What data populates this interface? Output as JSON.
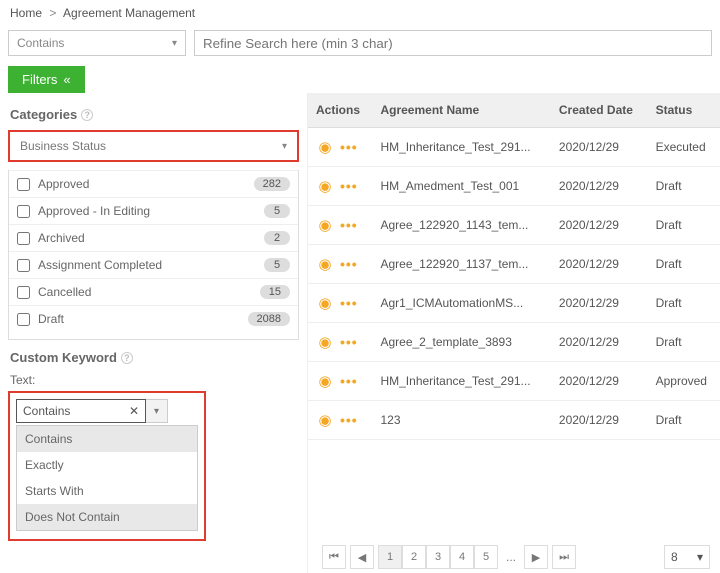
{
  "breadcrumb": {
    "home": "Home",
    "sep": ">",
    "current": "Agreement Management"
  },
  "search": {
    "mode": "Contains",
    "placeholder": "Refine Search here (min 3 char)"
  },
  "filters": {
    "label": "Filters",
    "glyph": "«"
  },
  "categories": {
    "title": "Categories",
    "selector": "Business Status",
    "items": [
      {
        "label": "Approved",
        "count": "282"
      },
      {
        "label": "Approved - In Editing",
        "count": "5"
      },
      {
        "label": "Archived",
        "count": "2"
      },
      {
        "label": "Assignment Completed",
        "count": "5"
      },
      {
        "label": "Cancelled",
        "count": "15"
      },
      {
        "label": "Draft",
        "count": "2088"
      }
    ]
  },
  "custom": {
    "title": "Custom Keyword",
    "text_label": "Text:",
    "value": "Contains",
    "options": [
      "Contains",
      "Exactly",
      "Starts With",
      "Does Not Contain"
    ]
  },
  "table": {
    "headers": {
      "actions": "Actions",
      "name": "Agreement Name",
      "date": "Created Date",
      "status": "Status"
    },
    "rows": [
      {
        "name": "HM_Inheritance_Test_291...",
        "date": "2020/12/29",
        "status": "Executed"
      },
      {
        "name": "HM_Amedment_Test_001",
        "date": "2020/12/29",
        "status": "Draft"
      },
      {
        "name": "Agree_122920_1143_tem...",
        "date": "2020/12/29",
        "status": "Draft"
      },
      {
        "name": "Agree_122920_1137_tem...",
        "date": "2020/12/29",
        "status": "Draft"
      },
      {
        "name": "Agr1_ICMAutomationMS...",
        "date": "2020/12/29",
        "status": "Draft"
      },
      {
        "name": "Agree_2_template_3893",
        "date": "2020/12/29",
        "status": "Draft"
      },
      {
        "name": "HM_Inheritance_Test_291...",
        "date": "2020/12/29",
        "status": "Approved"
      },
      {
        "name": "123",
        "date": "2020/12/29",
        "status": "Draft"
      }
    ]
  },
  "icons": {
    "first": "⏮",
    "prev": "◀",
    "next": "▶",
    "last": "⏭",
    "chev": "▾",
    "close": "✕",
    "eye": "◉",
    "dots": "•••"
  },
  "paginator": {
    "pages": [
      "1",
      "2",
      "3",
      "4",
      "5"
    ],
    "ellipsis": "...",
    "size": "8"
  }
}
